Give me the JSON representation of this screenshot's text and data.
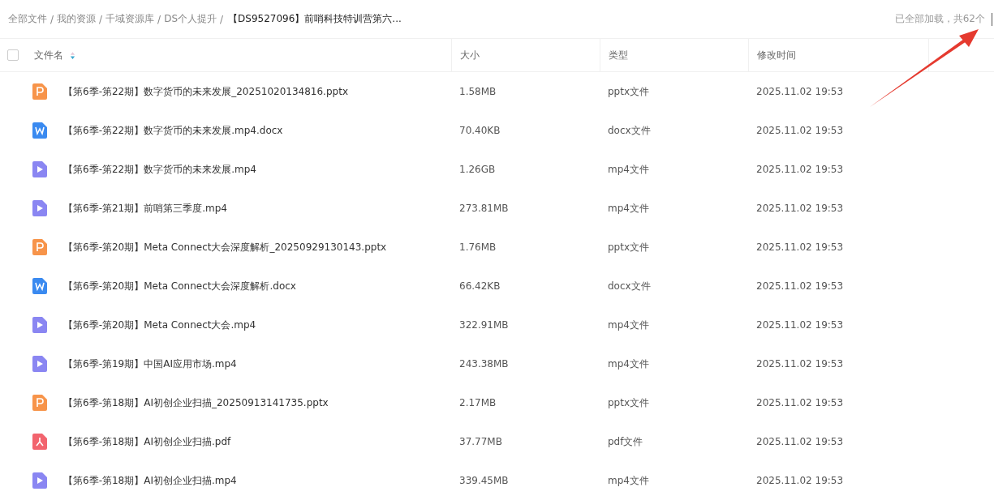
{
  "breadcrumb": {
    "items": [
      "全部文件",
      "我的资源",
      "千域资源库",
      "DS个人提升"
    ],
    "separator": "/",
    "current": "【DS9527096】前哨科技特训营第六..."
  },
  "load_status": "已全部加载，共62个",
  "table": {
    "select_all": {
      "checked": false
    },
    "columns": [
      {
        "label": "文件名",
        "sortable": true
      },
      {
        "label": "大小",
        "sortable": false
      },
      {
        "label": "类型",
        "sortable": false
      },
      {
        "label": "修改时间",
        "sortable": false
      }
    ],
    "rows": [
      {
        "kind": "pptx",
        "name": "【第6季-第22期】数字货币的未来发展_20251020134816.pptx",
        "size": "1.58MB",
        "type": "pptx文件",
        "modified": "2025.11.02 19:53"
      },
      {
        "kind": "docx",
        "name": "【第6季-第22期】数字货币的未来发展.mp4.docx",
        "size": "70.40KB",
        "type": "docx文件",
        "modified": "2025.11.02 19:53"
      },
      {
        "kind": "video",
        "name": "【第6季-第22期】数字货币的未来发展.mp4",
        "size": "1.26GB",
        "type": "mp4文件",
        "modified": "2025.11.02 19:53"
      },
      {
        "kind": "video",
        "name": "【第6季-第21期】前哨第三季度.mp4",
        "size": "273.81MB",
        "type": "mp4文件",
        "modified": "2025.11.02 19:53"
      },
      {
        "kind": "pptx",
        "name": "【第6季-第20期】Meta Connect大会深度解析_20250929130143.pptx",
        "size": "1.76MB",
        "type": "pptx文件",
        "modified": "2025.11.02 19:53"
      },
      {
        "kind": "docx",
        "name": "【第6季-第20期】Meta Connect大会深度解析.docx",
        "size": "66.42KB",
        "type": "docx文件",
        "modified": "2025.11.02 19:53"
      },
      {
        "kind": "video",
        "name": "【第6季-第20期】Meta Connect大会.mp4",
        "size": "322.91MB",
        "type": "mp4文件",
        "modified": "2025.11.02 19:53"
      },
      {
        "kind": "video",
        "name": "【第6季-第19期】中国AI应用市场.mp4",
        "size": "243.38MB",
        "type": "mp4文件",
        "modified": "2025.11.02 19:53"
      },
      {
        "kind": "pptx",
        "name": "【第6季-第18期】AI初创企业扫描_20250913141735.pptx",
        "size": "2.17MB",
        "type": "pptx文件",
        "modified": "2025.11.02 19:53"
      },
      {
        "kind": "pdf",
        "name": "【第6季-第18期】AI初创企业扫描.pdf",
        "size": "37.77MB",
        "type": "pdf文件",
        "modified": "2025.11.02 19:53"
      },
      {
        "kind": "video",
        "name": "【第6季-第18期】AI初创企业扫描.mp4",
        "size": "339.45MB",
        "type": "mp4文件",
        "modified": "2025.11.02 19:53"
      }
    ]
  }
}
